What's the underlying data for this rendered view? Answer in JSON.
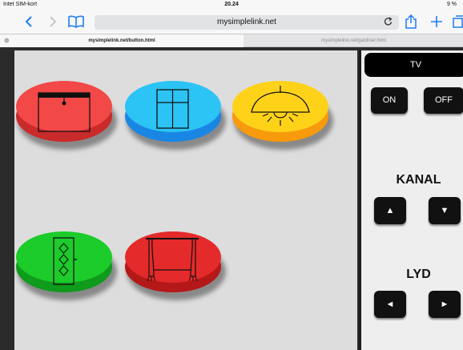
{
  "status_bar": {
    "carrier": "Intet SIM-kort",
    "time": "20.24",
    "battery": "9 %"
  },
  "toolbar": {
    "url": "mysimplelink.net",
    "icons": [
      "chevron-left-icon",
      "chevron-right-icon",
      "book-icon",
      "reload-icon",
      "share-icon",
      "plus-icon",
      "tabs-icon"
    ]
  },
  "tabs": [
    {
      "label": "mysimplelink.net/button.html"
    },
    {
      "label": "mysimplelink.net/gardiner.html"
    }
  ],
  "buttons": [
    {
      "name": "blind",
      "top_color": "#f24848",
      "side_color": "#c92a2a",
      "icon": "blind-icon"
    },
    {
      "name": "window",
      "top_color": "#2cc3f5",
      "side_color": "#1a86e3",
      "icon": "window-icon"
    },
    {
      "name": "lamp",
      "top_color": "#ffd21a",
      "side_color": "#f79a0c",
      "icon": "ceiling-lamp-icon"
    },
    {
      "name": "door",
      "top_color": "#1ccc2a",
      "side_color": "#0f9b1c",
      "icon": "door-icon"
    },
    {
      "name": "curtain",
      "top_color": "#e42a2a",
      "side_color": "#b51818",
      "icon": "curtain-icon"
    }
  ],
  "remote": {
    "title": "TV",
    "on_label": "ON",
    "off_label": "OFF",
    "channel_label": "KANAL",
    "volume_label": "LYD",
    "up": "▲",
    "down": "▼",
    "left": "◄",
    "right": "►"
  }
}
